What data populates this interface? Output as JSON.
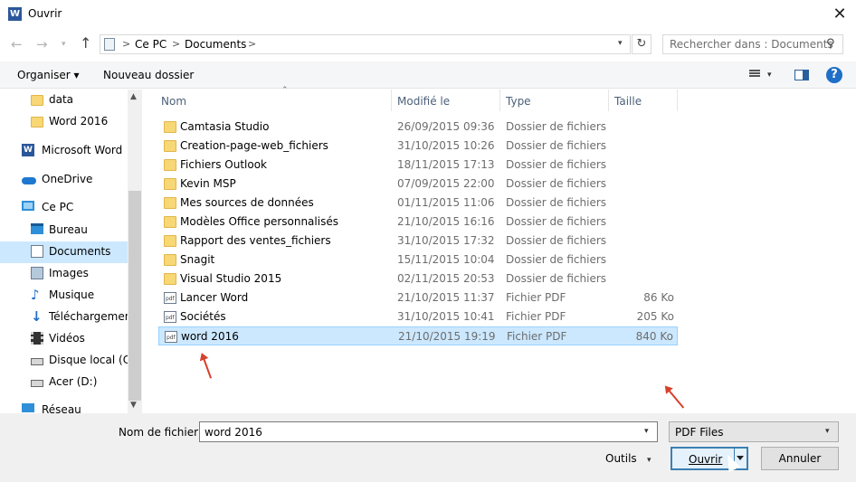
{
  "window": {
    "title": "Ouvrir",
    "app_icon": "W",
    "close": "✕"
  },
  "nav": {
    "back": "←",
    "forward": "→",
    "recent": "▾",
    "up": "↑",
    "breadcrumb": [
      "Ce PC",
      "Documents"
    ],
    "separator": ">",
    "refresh": "↻",
    "search_placeholder": "Rechercher dans : Documents",
    "search_icon": "⚲"
  },
  "toolbar": {
    "organise_label": "Organiser ▾",
    "new_folder_label": "Nouveau dossier",
    "help": "?"
  },
  "sidebar": {
    "items": [
      {
        "label": "data",
        "icon": "folder-icon"
      },
      {
        "label": "Word 2016",
        "icon": "folder-icon"
      },
      {
        "label": "Microsoft Word",
        "icon": "word-icon"
      },
      {
        "label": "OneDrive",
        "icon": "cloud-icon"
      },
      {
        "label": "Ce PC",
        "icon": "computer-icon"
      },
      {
        "label": "Bureau",
        "icon": "desktop-icon"
      },
      {
        "label": "Documents",
        "icon": "documents-icon",
        "selected": true
      },
      {
        "label": "Images",
        "icon": "pictures-icon"
      },
      {
        "label": "Musique",
        "icon": "music-icon"
      },
      {
        "label": "Téléchargement",
        "icon": "download-icon"
      },
      {
        "label": "Vidéos",
        "icon": "videos-icon"
      },
      {
        "label": "Disque local (C:)",
        "icon": "drive-icon"
      },
      {
        "label": "Acer (D:)",
        "icon": "drive-icon"
      },
      {
        "label": "Réseau",
        "icon": "network-icon"
      }
    ]
  },
  "files": {
    "columns": [
      "Nom",
      "Modifié le",
      "Type",
      "Taille"
    ],
    "rows": [
      {
        "name": "Camtasia Studio",
        "date": "26/09/2015 09:36",
        "type": "Dossier de fichiers",
        "size": "",
        "kind": "folder"
      },
      {
        "name": "Creation-page-web_fichiers",
        "date": "31/10/2015 10:26",
        "type": "Dossier de fichiers",
        "size": "",
        "kind": "folder"
      },
      {
        "name": "Fichiers Outlook",
        "date": "18/11/2015 17:13",
        "type": "Dossier de fichiers",
        "size": "",
        "kind": "folder"
      },
      {
        "name": "Kevin MSP",
        "date": "07/09/2015 22:00",
        "type": "Dossier de fichiers",
        "size": "",
        "kind": "folder"
      },
      {
        "name": "Mes sources de données",
        "date": "01/11/2015 11:06",
        "type": "Dossier de fichiers",
        "size": "",
        "kind": "folder"
      },
      {
        "name": "Modèles Office personnalisés",
        "date": "21/10/2015 16:16",
        "type": "Dossier de fichiers",
        "size": "",
        "kind": "folder"
      },
      {
        "name": "Rapport des ventes_fichiers",
        "date": "31/10/2015 17:32",
        "type": "Dossier de fichiers",
        "size": "",
        "kind": "folder"
      },
      {
        "name": "Snagit",
        "date": "15/11/2015 10:04",
        "type": "Dossier de fichiers",
        "size": "",
        "kind": "folder"
      },
      {
        "name": "Visual Studio 2015",
        "date": "02/11/2015 20:53",
        "type": "Dossier de fichiers",
        "size": "",
        "kind": "folder"
      },
      {
        "name": "Lancer Word",
        "date": "21/10/2015 11:37",
        "type": "Fichier PDF",
        "size": "86 Ko",
        "kind": "pdf"
      },
      {
        "name": "Sociétés",
        "date": "31/10/2015 10:41",
        "type": "Fichier PDF",
        "size": "205 Ko",
        "kind": "pdf"
      },
      {
        "name": "word 2016",
        "date": "21/10/2015 19:19",
        "type": "Fichier PDF",
        "size": "840 Ko",
        "kind": "pdf",
        "selected": true
      }
    ]
  },
  "footer": {
    "filename_label": "Nom de fichier :",
    "filename_value": "word 2016",
    "filter_value": "PDF Files",
    "tools_label": "Outils",
    "open_label": "Ouvrir",
    "cancel_label": "Annuler"
  },
  "colors": {
    "selection": "#cce8ff",
    "accent": "#3c7fb1",
    "annotation": "#d7412b"
  }
}
